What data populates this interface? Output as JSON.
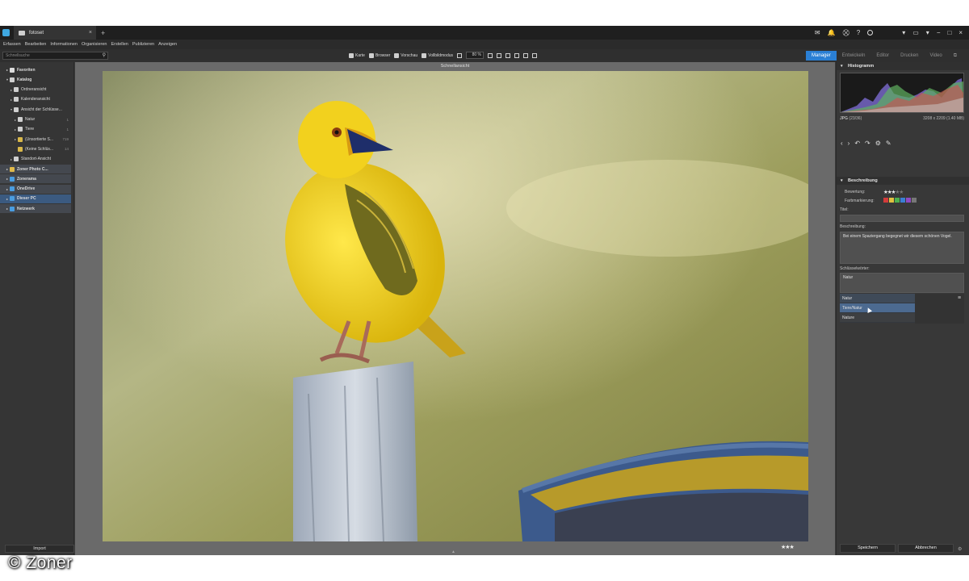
{
  "titlebar": {
    "tab_title": "fotoset",
    "tab_close": "×",
    "tab_add": "+",
    "right_icons": [
      "chat-icon",
      "notification-icon",
      "cart-icon",
      "help-icon",
      "user-icon"
    ],
    "help": "?",
    "window_controls": [
      "▾",
      "▭",
      "▾",
      "−",
      "□",
      "×"
    ]
  },
  "menu": [
    "Erfassen",
    "Bearbeiten",
    "Informationen",
    "Organisieren",
    "Erstellen",
    "Publizieren",
    "Anzeigen"
  ],
  "toolbar": {
    "search_placeholder": "Schnellsuche",
    "view_modes": [
      "Karte",
      "Browser",
      "Vorschau",
      "Vollbildmodus"
    ],
    "zoom": "80 %"
  },
  "modules": [
    "Manager",
    "Entwickeln",
    "Editor",
    "Drucken",
    "Video"
  ],
  "active_module": "Manager",
  "navigator": [
    {
      "label": "Favoriten",
      "level": 0,
      "bold": true,
      "arrow": "▸",
      "color": "#dddddd"
    },
    {
      "label": "Katalog",
      "level": 0,
      "bold": true,
      "arrow": "▾",
      "color": "#cfcfcf"
    },
    {
      "label": "Ordneransicht",
      "level": 1,
      "arrow": "▸",
      "color": "#cfcfcf"
    },
    {
      "label": "Kalenderansicht",
      "level": 1,
      "arrow": "▸",
      "color": "#cfcfcf"
    },
    {
      "label": "Ansicht der Schlüsse...",
      "level": 1,
      "arrow": "▾",
      "color": "#cfcfcf"
    },
    {
      "label": "Natur",
      "level": 2,
      "arrow": "▸",
      "color": "#cfcfcf",
      "count": "1"
    },
    {
      "label": "Tiere",
      "level": 2,
      "arrow": "▸",
      "color": "#cfcfcf",
      "count": "1"
    },
    {
      "label": "(Unsortierte S...",
      "level": 2,
      "arrow": "▸",
      "color": "#d9b84a",
      "count": "719"
    },
    {
      "label": "(Keine Schlüs...",
      "level": 2,
      "arrow": "",
      "color": "#d9b84a",
      "count": "14"
    },
    {
      "label": "Standort-Ansicht",
      "level": 1,
      "arrow": "▸",
      "color": "#cfcfcf"
    },
    {
      "label": "Zoner Photo C...",
      "level": 0,
      "bold": true,
      "arrow": "▸",
      "color": "#e0b94a",
      "highlight": true
    },
    {
      "label": "Zonerama",
      "level": 0,
      "bold": true,
      "arrow": "▸",
      "color": "#4a9de0",
      "highlight": true
    },
    {
      "label": "OneDrive",
      "level": 0,
      "bold": true,
      "arrow": "▸",
      "color": "#4a9de0",
      "highlight": true
    },
    {
      "label": "Dieser PC",
      "level": 0,
      "bold": true,
      "arrow": "▸",
      "color": "#4a9de0",
      "selected": true
    },
    {
      "label": "Netzwerk",
      "level": 0,
      "bold": true,
      "arrow": "▸",
      "color": "#4a9de0",
      "highlight": true
    }
  ],
  "import_label": "Import",
  "preview": {
    "title": "Schnellansicht",
    "rating": "★★★"
  },
  "right_panel": {
    "histogram_title": "Histogramm",
    "file_type": "JPG",
    "file_info": "(23/36)",
    "resolution": "3208 x 2209 (1.40 MB)",
    "description_section": "Beschreibung",
    "rating_label": "Bewertung:",
    "rating_value": 3,
    "color_label": "Farbmarkierung:",
    "color_swatches": [
      "#d23b3b",
      "#e0c040",
      "#4caf50",
      "#3a7fd4",
      "#8e4ac2",
      "#777777"
    ],
    "title_label": "Titel:",
    "title_value": "",
    "description_label": "Beschreibung:",
    "description_value": "Bei einem Spaziergang begegnet wir diesem schönen Vogel.",
    "keywords_label": "Schlüsselwörter:",
    "keywords_value": "Natur",
    "suggestions": [
      "Natur",
      "Tiere/Natur",
      "Nature"
    ],
    "save": "Speichern",
    "cancel": "Abbrechen"
  },
  "watermark": "© Zoner"
}
